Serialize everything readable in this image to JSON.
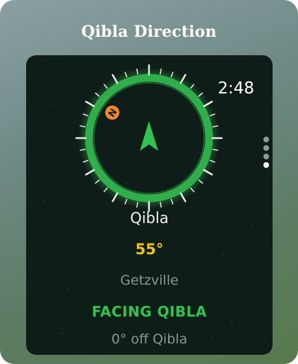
{
  "title": "Qibla Direction",
  "watch": {
    "time": "2:48",
    "north_badge_letter": "N",
    "qibla_label": "Qibla",
    "qibla_degrees": "55°",
    "city": "Getzville",
    "status": "FACING QIBLA",
    "offset": "0° off Qibla"
  },
  "pager": {
    "pages": 4,
    "active_index": 3
  },
  "colors": {
    "ring": "#2fae4a",
    "arrow": "#2fc44f",
    "north_badge": "#f0892a",
    "degrees": "#f1c40f",
    "status": "#2fc44f"
  },
  "icons": {
    "north": "north-badge-icon",
    "arrow": "qibla-arrow-icon"
  }
}
